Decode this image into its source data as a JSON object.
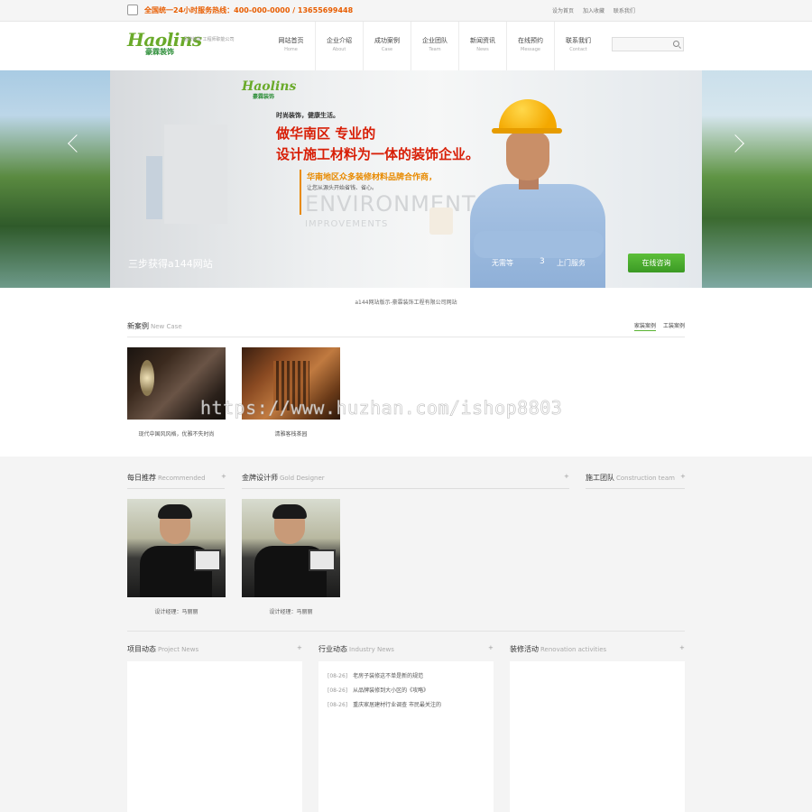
{
  "topbar": {
    "hotline": "全国统一24小时服务热线：400-000-0000  /  13655699448",
    "links": [
      "设为首页",
      "加入收藏",
      "联系我们"
    ]
  },
  "header": {
    "logo_en": "Haolins",
    "logo_cn": "豪霖装饰",
    "slogan": "品牌装饰 工程师职能公司",
    "nav": [
      {
        "cn": "网站首页",
        "en": "Home"
      },
      {
        "cn": "企业介绍",
        "en": "About"
      },
      {
        "cn": "成功案例",
        "en": "Case"
      },
      {
        "cn": "企业团队",
        "en": "Team"
      },
      {
        "cn": "新闻资讯",
        "en": "News"
      },
      {
        "cn": "在线预约",
        "en": "Message"
      },
      {
        "cn": "联系我们",
        "en": "Contact"
      }
    ],
    "search_placeholder": ""
  },
  "banner": {
    "logo_en": "Haolins",
    "logo_cn": "豪霖装饰",
    "tagline": "时尚装饰，健康生活。",
    "headline1": "做华南区  专业的",
    "headline2": "设计施工材料为一体的装饰企业。",
    "sub1": "华南地区众多装修材料品牌合作商，",
    "sub2": "让您从源头开始省钱、省心。",
    "env": "ENVIRONMENT",
    "imp": "IMPROVEMENTS",
    "caption": "三步获得a144网站",
    "caption2": "无需等",
    "num": "3",
    "more": "上门服务",
    "consult": "在线咨询"
  },
  "copyright": "a144网站版示-豪霖装饰工程有限公司网站",
  "new_case": {
    "title_cn": "新案例",
    "title_en": "New Case",
    "tabs": [
      "家装案例",
      "工装案例"
    ],
    "items": [
      {
        "caption": "现代中国风风格，优雅不失时尚"
      },
      {
        "caption": "清雅客栈茶园"
      }
    ]
  },
  "watermark": "https://www.huzhan.com/ishop8803",
  "recommended": {
    "title_cn": "每日推荐",
    "title_en": "Recommended"
  },
  "gold_designer": {
    "title_cn": "金牌设计师",
    "title_en": "Gold Designer"
  },
  "construction_team": {
    "title_cn": "施工团队",
    "title_en": "Construction team"
  },
  "designers": [
    {
      "caption": "设计经理：马丽丽"
    },
    {
      "caption": "设计经理：马丽丽"
    }
  ],
  "project_news": {
    "title_cn": "项目动态",
    "title_en": "Project News"
  },
  "industry_news": {
    "title_cn": "行业动态",
    "title_en": "Industry News",
    "items": [
      {
        "date": "[08-26]",
        "title": "老房子装修这不单是新的规范"
      },
      {
        "date": "[08-26]",
        "title": "从品牌装修到大小区的《攻略》"
      },
      {
        "date": "[08-26]",
        "title": "重庆家居建材行业调查 市民最关注的"
      }
    ]
  },
  "renovation": {
    "title_cn": "装修活动",
    "title_en": "Renovation activities"
  },
  "colors": {
    "accent": "#5ab332",
    "hotline": "#e85d00",
    "headline": "#d81e06"
  }
}
